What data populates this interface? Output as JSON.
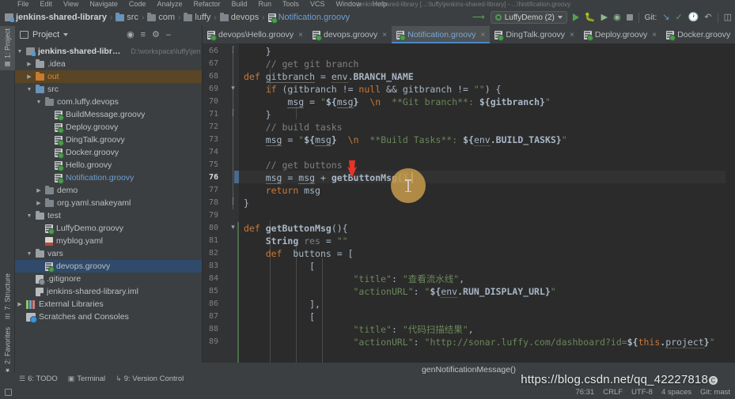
{
  "window": {
    "title": "jenkins-shared-library [...:\\luffy\\jenkins-shared-library] - ...\\Notification.groovy"
  },
  "menubar": {
    "items": [
      "File",
      "Edit",
      "View",
      "Navigate",
      "Code",
      "Analyze",
      "Refactor",
      "Build",
      "Run",
      "Tools",
      "VCS",
      "Window",
      "Help"
    ]
  },
  "breadcrumb": {
    "items": [
      {
        "label": "jenkins-shared-library",
        "icon": "module-icon"
      },
      {
        "label": "src",
        "icon": "folder-icon"
      },
      {
        "label": "com",
        "icon": "package-icon"
      },
      {
        "label": "luffy",
        "icon": "package-icon"
      },
      {
        "label": "devops",
        "icon": "package-icon"
      },
      {
        "label": "Notification.groovy",
        "icon": "groovy-file-icon"
      }
    ],
    "separator": "›"
  },
  "run_toolbar": {
    "back_icon": "back-arrow-icon",
    "config_name": "LuffyDemo (2)",
    "run_icon": "run-icon",
    "debug_icon": "debug-icon",
    "run_coverage_icon": "run-with-coverage-icon",
    "profile_icon": "profile-icon",
    "stop_icon": "stop-icon",
    "git_label": "Git:",
    "update_icon": "update-project-icon",
    "commit_icon": "commit-icon",
    "history_icon": "history-icon",
    "rollback_icon": "rollback-icon",
    "search_icon": "search-everywhere-icon"
  },
  "rail": {
    "items": [
      {
        "label": "1: Project",
        "selected": true,
        "icon": "project-icon"
      },
      {
        "label": "7: Structure",
        "selected": false,
        "icon": "structure-icon"
      },
      {
        "label": "2: Favorites",
        "selected": false,
        "icon": "star-icon"
      }
    ]
  },
  "project_panel": {
    "title": "Project",
    "dropdown_icon": "chevron-down-icon",
    "tools": [
      "locate-icon",
      "expand-collapse-icon",
      "settings-icon",
      "hide-icon"
    ],
    "tree": [
      {
        "indent": 0,
        "arrow": "▼",
        "icon": "module-icon",
        "label": "jenkins-shared-library",
        "style": "bold",
        "path": "D:\\workspace\\luffy\\jen",
        "row": "normal"
      },
      {
        "indent": 1,
        "arrow": "▶",
        "icon": "folder-grey",
        "label": ".idea",
        "style": "",
        "path": "",
        "row": "normal"
      },
      {
        "indent": 1,
        "arrow": "▶",
        "icon": "folder-orange",
        "label": "out",
        "style": "orange",
        "path": "",
        "row": "sel-orange"
      },
      {
        "indent": 1,
        "arrow": "▼",
        "icon": "folder-blue",
        "label": "src",
        "style": "",
        "path": "",
        "row": "normal"
      },
      {
        "indent": 2,
        "arrow": "▼",
        "icon": "package-icon",
        "label": "com.luffy.devops",
        "style": "",
        "path": "",
        "row": "normal"
      },
      {
        "indent": 3,
        "arrow": "",
        "icon": "groovy-file-icon",
        "label": "BuildMessage.groovy",
        "style": "",
        "path": "",
        "row": "normal"
      },
      {
        "indent": 3,
        "arrow": "",
        "icon": "groovy-file-icon",
        "label": "Deploy.groovy",
        "style": "",
        "path": "",
        "row": "normal"
      },
      {
        "indent": 3,
        "arrow": "",
        "icon": "groovy-file-icon",
        "label": "DingTalk.groovy",
        "style": "",
        "path": "",
        "row": "normal"
      },
      {
        "indent": 3,
        "arrow": "",
        "icon": "groovy-file-icon",
        "label": "Docker.groovy",
        "style": "",
        "path": "",
        "row": "normal"
      },
      {
        "indent": 3,
        "arrow": "",
        "icon": "groovy-file-icon",
        "label": "Hello.groovy",
        "style": "",
        "path": "",
        "row": "normal"
      },
      {
        "indent": 3,
        "arrow": "",
        "icon": "groovy-file-icon",
        "label": "Notification.groovy",
        "style": "blue",
        "path": "",
        "row": "normal"
      },
      {
        "indent": 2,
        "arrow": "▶",
        "icon": "package-icon",
        "label": "demo",
        "style": "",
        "path": "",
        "row": "normal"
      },
      {
        "indent": 2,
        "arrow": "▶",
        "icon": "package-icon",
        "label": "org.yaml.snakeyaml",
        "style": "",
        "path": "",
        "row": "normal"
      },
      {
        "indent": 1,
        "arrow": "▼",
        "icon": "folder-grey",
        "label": "test",
        "style": "",
        "path": "",
        "row": "normal"
      },
      {
        "indent": 2,
        "arrow": "",
        "icon": "groovy-file-icon",
        "label": "LuffyDemo.groovy",
        "style": "",
        "path": "",
        "row": "normal"
      },
      {
        "indent": 2,
        "arrow": "",
        "icon": "yaml-file-icon",
        "label": "myblog.yaml",
        "style": "",
        "path": "",
        "row": "normal"
      },
      {
        "indent": 1,
        "arrow": "▼",
        "icon": "folder-grey",
        "label": "vars",
        "style": "",
        "path": "",
        "row": "normal"
      },
      {
        "indent": 2,
        "arrow": "",
        "icon": "groovy-file-icon",
        "label": "devops.groovy",
        "style": "",
        "path": "",
        "row": "sel-blue"
      },
      {
        "indent": 1,
        "arrow": "",
        "icon": "gitignore-icon",
        "label": ".gitignore",
        "style": "",
        "path": "",
        "row": "normal"
      },
      {
        "indent": 1,
        "arrow": "",
        "icon": "iml-file-icon",
        "label": "jenkins-shared-library.iml",
        "style": "",
        "path": "",
        "row": "normal"
      },
      {
        "indent": 0,
        "arrow": "▶",
        "icon": "library-icon",
        "label": "External Libraries",
        "style": "",
        "path": "",
        "row": "normal"
      },
      {
        "indent": 0,
        "arrow": "",
        "icon": "scratches-icon",
        "label": "Scratches and Consoles",
        "style": "",
        "path": "",
        "row": "normal"
      }
    ]
  },
  "editor_tabs": [
    {
      "label": "devops\\Hello.groovy",
      "active": false,
      "icon": "groovy-file-icon",
      "close": "×"
    },
    {
      "label": "devops.groovy",
      "active": false,
      "icon": "groovy-file-icon",
      "close": "×"
    },
    {
      "label": "Notification.groovy",
      "active": true,
      "icon": "groovy-file-icon",
      "close": "×"
    },
    {
      "label": "DingTalk.groovy",
      "active": false,
      "icon": "groovy-file-icon",
      "close": "×"
    },
    {
      "label": "Deploy.groovy",
      "active": false,
      "icon": "groovy-file-icon",
      "close": "×"
    },
    {
      "label": "Docker.groovy",
      "active": false,
      "icon": "groovy-file-icon",
      "close": "×"
    }
  ],
  "editor": {
    "first_line": 66,
    "current_line": 76,
    "lines": [
      {
        "n": 66,
        "text": "    }"
      },
      {
        "n": 67,
        "text": "    // get git branch"
      },
      {
        "n": 68,
        "text": "    def gitbranch = env.BRANCH_NAME"
      },
      {
        "n": 69,
        "text": "    if (gitbranch != null && gitbranch != \"\") {"
      },
      {
        "n": 70,
        "text": "        msg = \"${msg}  \\n  **Git branch**: ${gitbranch}\""
      },
      {
        "n": 71,
        "text": "    }"
      },
      {
        "n": 72,
        "text": "    // build tasks"
      },
      {
        "n": 73,
        "text": "    msg = \"${msg}  \\n  **Build Tasks**: ${env.BUILD_TASKS}\""
      },
      {
        "n": 74,
        "text": ""
      },
      {
        "n": 75,
        "text": "    // get buttons"
      },
      {
        "n": 76,
        "text": "    msg = msg + getButtonMsg()"
      },
      {
        "n": 77,
        "text": "    return msg"
      },
      {
        "n": 78,
        "text": "}"
      },
      {
        "n": 79,
        "text": ""
      },
      {
        "n": 80,
        "text": "def getButtonMsg(){"
      },
      {
        "n": 81,
        "text": "    String res = \"\""
      },
      {
        "n": 82,
        "text": "    def  buttons = ["
      },
      {
        "n": 83,
        "text": "            ["
      },
      {
        "n": 84,
        "text": "                    \"title\": \"查看流水线\","
      },
      {
        "n": 85,
        "text": "                    \"actionURL\": \"${env.RUN_DISPLAY_URL}\""
      },
      {
        "n": 86,
        "text": "            ],"
      },
      {
        "n": 87,
        "text": "            ["
      },
      {
        "n": 88,
        "text": "                    \"title\": \"代码扫描结果\","
      },
      {
        "n": 89,
        "text": "                    \"actionURL\": \"http://sonar.luffy.com/dashboard?id=${this.project}\""
      }
    ],
    "breadcrumb": "genNotificationMessage()"
  },
  "bottom_tools": [
    {
      "label": "6: TODO",
      "icon": "todo-icon"
    },
    {
      "label": "Terminal",
      "icon": "terminal-icon"
    },
    {
      "label": "9: Version Control",
      "icon": "version-control-icon"
    }
  ],
  "statusbar": {
    "left_icon": "event-log-icon",
    "position": "76:31",
    "line_separator": "CRLF",
    "encoding": "UTF-8",
    "indent": "4 spaces",
    "branch": "Git: mast"
  },
  "watermark": {
    "text": "https://blog.csdn.net/qq_42227818",
    "badge": "C"
  },
  "colors": {
    "accent_blue": "#4a88c7",
    "selection_blue": "#2f4a6b",
    "selection_orange": "#5a4526",
    "editor_bg": "#2b2b2b",
    "panel_bg": "#3c3f41",
    "cursor_blob": "#c79a4b",
    "red_arrow": "#e8322a"
  }
}
